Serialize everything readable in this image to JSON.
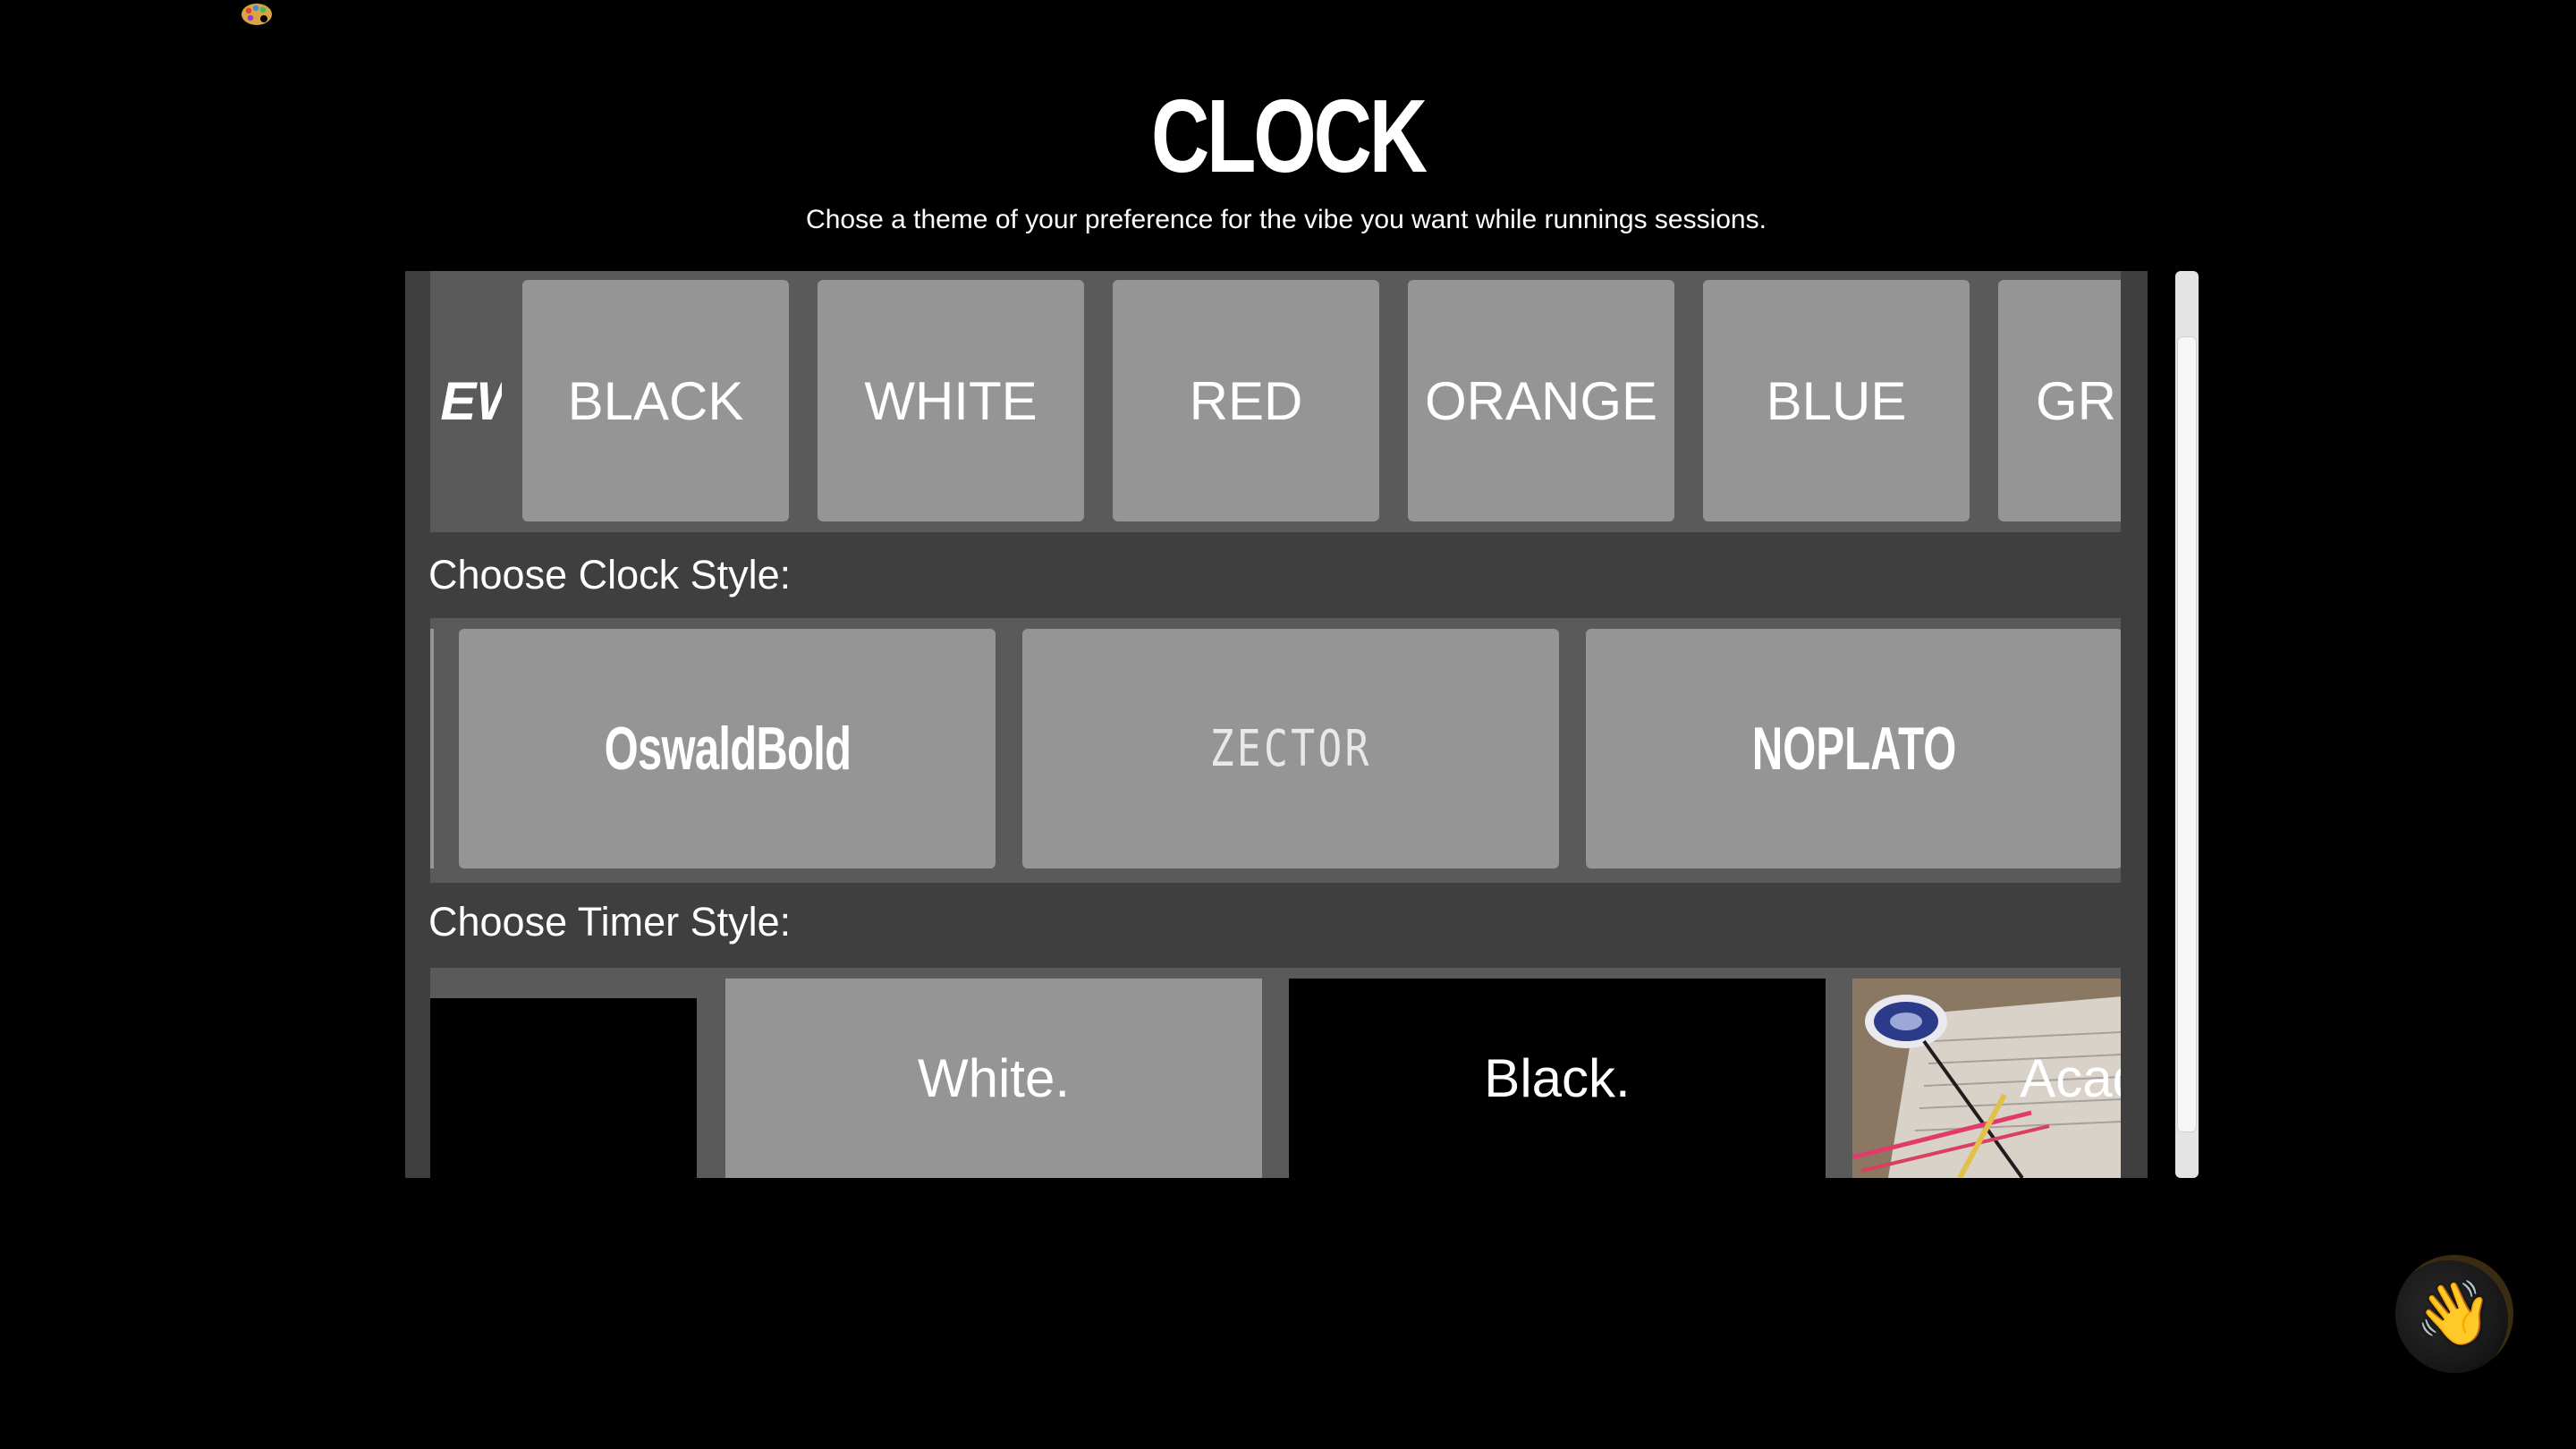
{
  "header": {
    "title": "CLOCK",
    "subtitle": "Chose a theme of your preference for the vibe you want while runnings sessions."
  },
  "color_themes": {
    "partial_label": "EW",
    "items": [
      "BLACK",
      "WHITE",
      "RED",
      "ORANGE",
      "BLUE",
      "GR"
    ]
  },
  "clock_style": {
    "label": "Choose Clock Style:",
    "items": [
      "OswaldBold",
      "ZECTOR",
      "NOPLATO"
    ]
  },
  "timer_style": {
    "label": "Choose Timer Style:",
    "items": [
      "White.",
      "Black.",
      "Acad"
    ]
  },
  "icons": {
    "corner": "palette-icon",
    "floating": "waving-hand-icon"
  },
  "colors": {
    "background": "#000000",
    "panel": "#3f3f3f",
    "strip": "#5a5a5a",
    "tile": "#959595",
    "text": "#ffffff"
  }
}
